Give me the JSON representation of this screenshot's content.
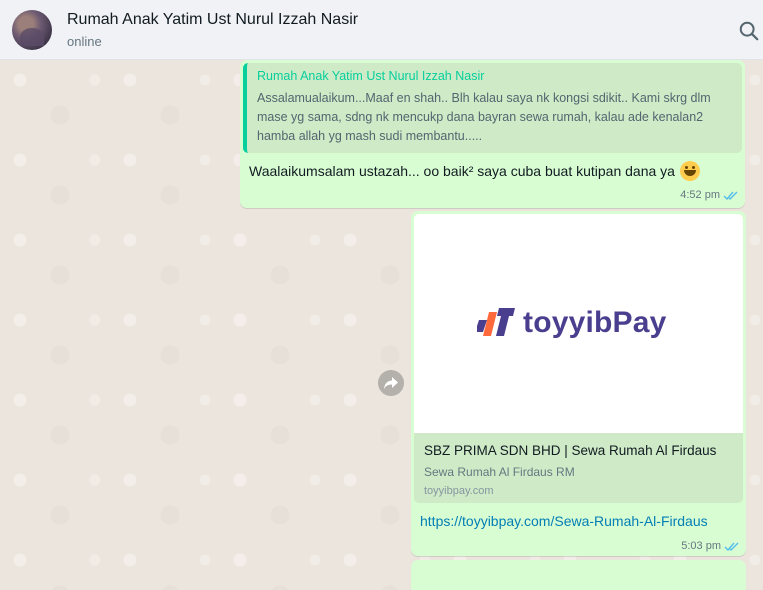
{
  "header": {
    "title": "Rumah Anak Yatim Ust Nurul Izzah Nasir",
    "status": "online"
  },
  "messages": [
    {
      "quote_author": "Rumah Anak Yatim Ust Nurul Izzah Nasir",
      "quote_text": "Assalamualaikum...Maaf en shah.. Blh kalau saya nk kongsi sdikit.. Kami skrg dlm mase yg sama, sdng nk mencukp dana bayran sewa rumah, kalau ade kenalan2 hamba allah yg mash sudi membantu.....",
      "text": "Waalaikumsalam ustazah... oo baik² saya cuba buat kutipan dana ya",
      "time": "4:52 pm"
    },
    {
      "preview_logo": "toyyibPay",
      "preview_title": "SBZ PRIMA SDN BHD | Sewa Rumah Al Firdaus",
      "preview_description": "Sewa Rumah Al Firdaus RM",
      "preview_domain": "toyyibpay.com",
      "link": "https://toyyibpay.com/Sewa-Rumah-Al-Firdaus",
      "time": "5:03 pm"
    }
  ],
  "icons": {
    "search": "search-icon",
    "forward": "forward-icon",
    "read_receipt": "double-check-icon",
    "emoji": "grinning-face-emoji"
  },
  "colors": {
    "outgoing_bubble": "#d9fdd3",
    "quote_accent": "#06cf9c",
    "link": "#027eb5",
    "read_tick": "#53bdeb",
    "brand_purple": "#4a3f8f"
  }
}
